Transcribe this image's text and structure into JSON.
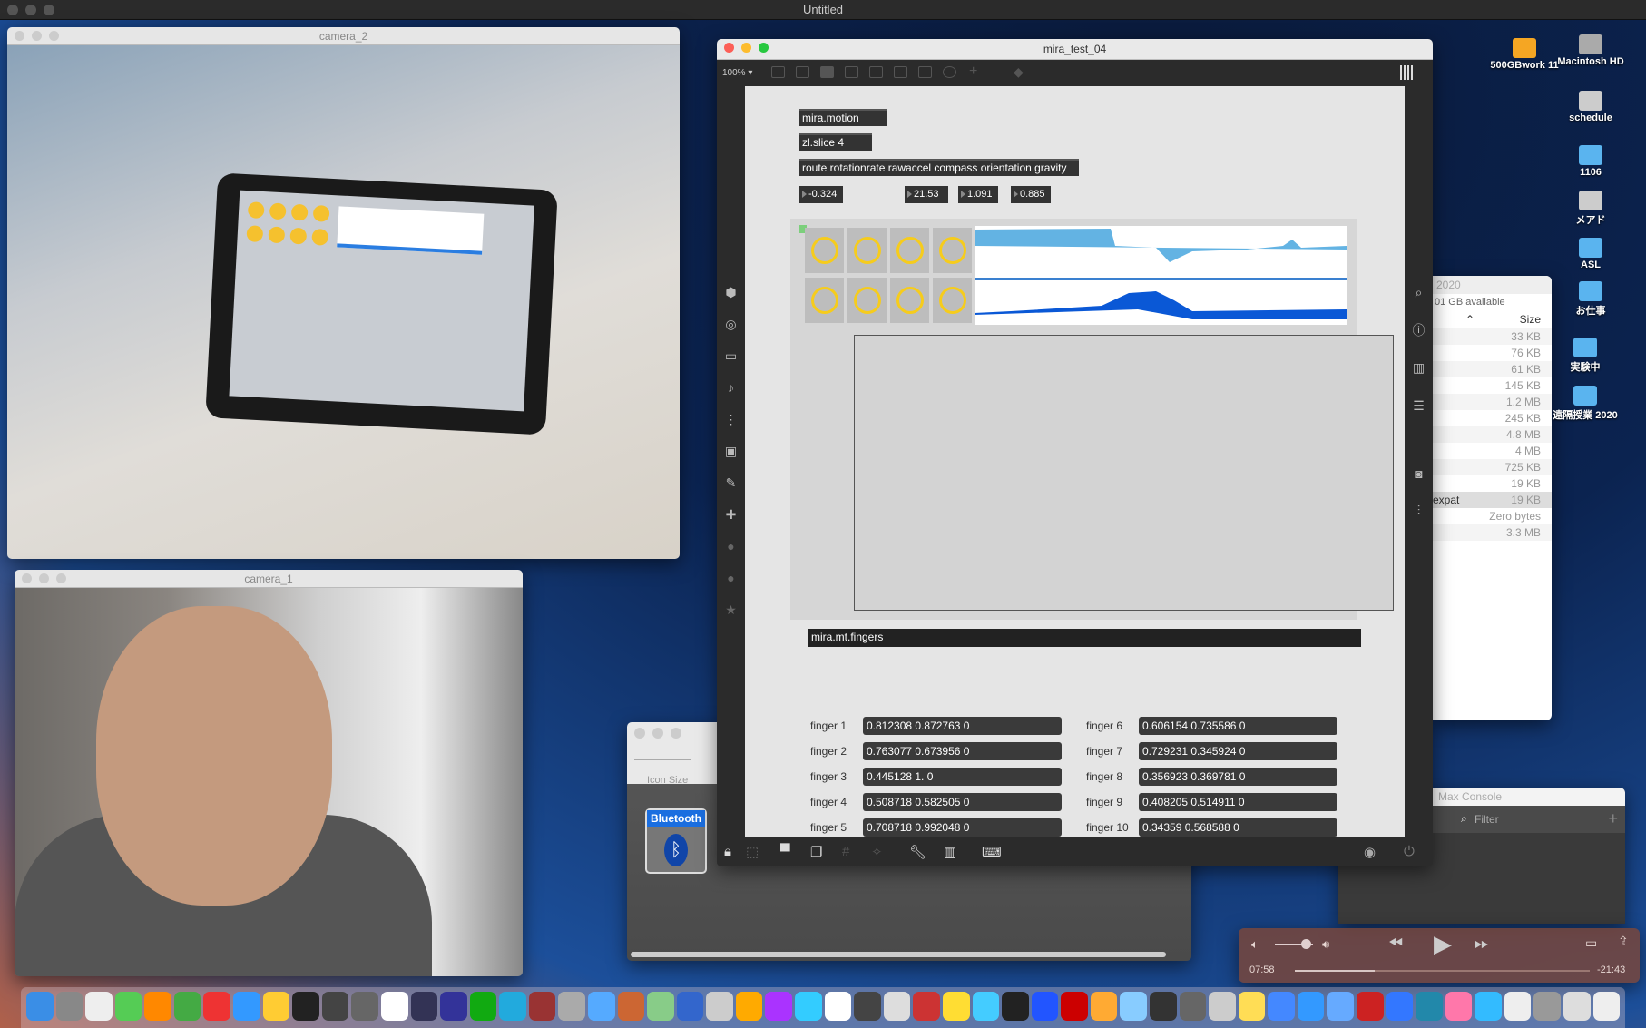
{
  "menubar": {
    "title": "Untitled"
  },
  "camera2": {
    "title": "camera_2"
  },
  "camera1": {
    "title": "camera_1"
  },
  "max": {
    "title": "mira_test_04",
    "zoom": "100%",
    "objects": {
      "motion": "mira.motion",
      "slice": "zl.slice 4",
      "route": "route rotationrate rawaccel compass orientation gravity",
      "fingers": "mira.mt.fingers"
    },
    "numbers": [
      "-0.324",
      "21.53",
      "1.091",
      "0.885"
    ],
    "fingers": [
      {
        "label": "finger 1",
        "value": "0.812308 0.872763 0"
      },
      {
        "label": "finger 2",
        "value": "0.763077 0.673956 0"
      },
      {
        "label": "finger 3",
        "value": "0.445128 1. 0"
      },
      {
        "label": "finger 4",
        "value": "0.508718 0.582505 0"
      },
      {
        "label": "finger 5",
        "value": "0.708718 0.992048 0"
      },
      {
        "label": "finger 6",
        "value": "0.606154 0.735586 0"
      },
      {
        "label": "finger 7",
        "value": "0.729231 0.345924 0"
      },
      {
        "label": "finger 8",
        "value": "0.356923 0.369781 0"
      },
      {
        "label": "finger 9",
        "value": "0.408205 0.514911 0"
      },
      {
        "label": "finger 10",
        "value": "0.34359 0.568588 0"
      }
    ]
  },
  "finder": {
    "title": "2020",
    "available": "01 GB available",
    "size_header": "Size",
    "selected_name": "expat",
    "sizes": [
      "33 KB",
      "76 KB",
      "61 KB",
      "145 KB",
      "1.2 MB",
      "245 KB",
      "4.8 MB",
      "4 MB",
      "725 KB",
      "19 KB",
      "19 KB",
      "Zero bytes",
      "3.3 MB"
    ]
  },
  "console": {
    "title": "Max Console",
    "filter_placeholder": "Filter"
  },
  "iconwin": {
    "icon_size_label": "Icon Size",
    "bluetooth_label": "Bluetooth"
  },
  "quicktime": {
    "elapsed": "07:58",
    "remaining": "-21:43",
    "progress": 0.27,
    "volume": 0.8
  },
  "desktop": [
    {
      "label": "500GBwork 11",
      "color": "#f5a623"
    },
    {
      "label": "Macintosh HD",
      "color": "#aaaaaa"
    },
    {
      "label": "schedule",
      "color": "#cccccc"
    },
    {
      "label": "1106",
      "color": "#5ab4ef"
    },
    {
      "label": "メアド",
      "color": "#cccccc"
    },
    {
      "label": "ASL",
      "color": "#5ab4ef"
    },
    {
      "label": "お仕事",
      "color": "#5ab4ef"
    },
    {
      "label": "実験中",
      "color": "#5ab4ef"
    },
    {
      "label": "遠隔授業 2020",
      "color": "#5ab4ef"
    }
  ]
}
